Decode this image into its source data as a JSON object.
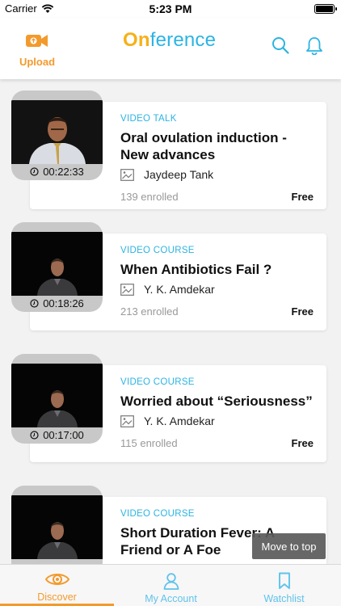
{
  "status_bar": {
    "carrier": "Carrier",
    "time": "5:23 PM"
  },
  "header": {
    "upload_label": "Upload",
    "logo_on": "On",
    "logo_rest": "ference"
  },
  "colors": {
    "accent_orange": "#f39a2c",
    "accent_blue": "#2bb4e3",
    "logo_yellow": "#f6b018"
  },
  "courses": [
    {
      "type": "VIDEO TALK",
      "title": "Oral ovulation induction - New advances",
      "author": "Jaydeep Tank",
      "duration": "00:22:33",
      "enrolled": "139 enrolled",
      "price": "Free"
    },
    {
      "type": "VIDEO COURSE",
      "title": "When Antibiotics Fail ?",
      "author": "Y. K. Amdekar",
      "duration": "00:18:26",
      "enrolled": "213 enrolled",
      "price": "Free"
    },
    {
      "type": "VIDEO COURSE",
      "title": "Worried about “Seriousness”",
      "author": "Y. K. Amdekar",
      "duration": "00:17:00",
      "enrolled": "115 enrolled",
      "price": "Free"
    },
    {
      "type": "VIDEO COURSE",
      "title": "Short Duration Fever: A Friend or A Foe",
      "author": "",
      "duration": "",
      "enrolled": "",
      "price": ""
    }
  ],
  "move_to_top": "Move to top",
  "tabs": [
    {
      "label": "Discover",
      "icon": "eye-icon"
    },
    {
      "label": "My Account",
      "icon": "person-icon"
    },
    {
      "label": "Watchlist",
      "icon": "bookmark-icon"
    }
  ]
}
